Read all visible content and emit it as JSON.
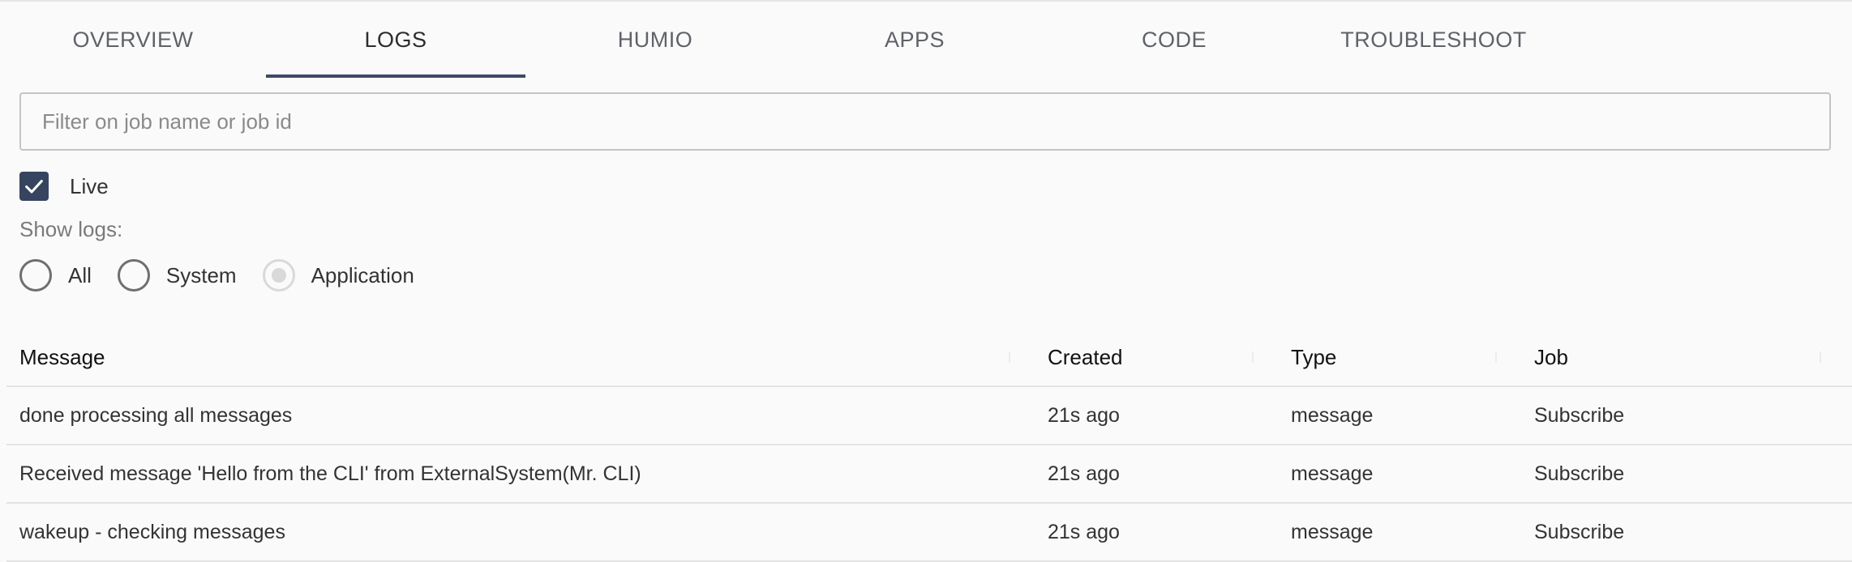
{
  "tabs": [
    {
      "label": "OVERVIEW",
      "active": false
    },
    {
      "label": "LOGS",
      "active": true
    },
    {
      "label": "HUMIO",
      "active": false
    },
    {
      "label": "APPS",
      "active": false
    },
    {
      "label": "CODE",
      "active": false
    },
    {
      "label": "TROUBLESHOOT",
      "active": false
    }
  ],
  "filter": {
    "placeholder": "Filter on job name or job id",
    "value": ""
  },
  "live": {
    "label": "Live",
    "checked": true
  },
  "show_logs": {
    "label": "Show logs:",
    "options": [
      {
        "label": "All",
        "checked": false
      },
      {
        "label": "System",
        "checked": false
      },
      {
        "label": "Application",
        "checked": true
      }
    ]
  },
  "table": {
    "columns": [
      "Message",
      "Created",
      "Type",
      "Job"
    ],
    "rows": [
      {
        "message": "done processing all messages",
        "created": "21s ago",
        "type": "message",
        "job": "Subscribe"
      },
      {
        "message": "Received message 'Hello from the CLI' from ExternalSystem(Mr. CLI)",
        "created": "21s ago",
        "type": "message",
        "job": "Subscribe"
      },
      {
        "message": "wakeup - checking messages",
        "created": "21s ago",
        "type": "message",
        "job": "Subscribe"
      }
    ]
  },
  "colors": {
    "accent": "#3b4a66",
    "checkbox": "#37445f",
    "border": "#c4c4c4",
    "divider": "#e3e3e3"
  }
}
